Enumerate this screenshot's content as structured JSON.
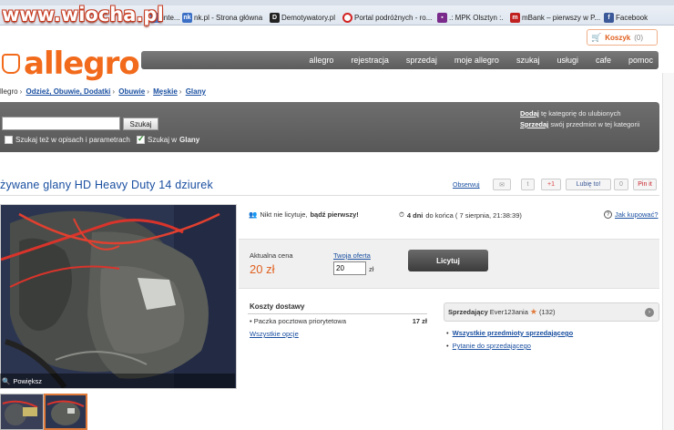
{
  "watermark": "www.wiocha.pl",
  "bookmarks": [
    {
      "label": "inte...",
      "icon": "ie-icon",
      "color": "#4a7bd0"
    },
    {
      "label": "nk.pl - Strona główna",
      "icon": "nk-icon",
      "color": "#3b6fc6"
    },
    {
      "label": "Demotywatory.pl",
      "icon": "d-icon",
      "color": "#222222"
    },
    {
      "label": "Portal podróżnych - ro...",
      "icon": "target-icon",
      "color": "#d22222"
    },
    {
      "label": ".: MPK Olsztyn :.",
      "icon": "bus-icon",
      "color": "#7a2a8a"
    },
    {
      "label": "mBank – pierwszy w P...",
      "icon": "mbank-icon",
      "color": "#c02020"
    },
    {
      "label": "Facebook",
      "icon": "facebook-icon",
      "color": "#3b5998"
    }
  ],
  "header": {
    "cart_label": "Koszyk",
    "cart_count": "(0)",
    "logo_text": "allegro",
    "nav": [
      "allegro",
      "rejestracja",
      "sprzedaj",
      "moje allegro",
      "szukaj",
      "usługi",
      "cafe",
      "pomoc"
    ]
  },
  "breadcrumb": {
    "root": "llegro",
    "items": [
      "Odzież, Obuwie, Dodatki",
      "Obuwie",
      "Męskie",
      "Glany"
    ]
  },
  "search": {
    "button_label": "Szukaj",
    "option_descriptions": "Szukaj też w opisach i parametrach",
    "option_in_prefix": "Szukaj w",
    "option_in_category": "Glany",
    "add_link": "Dodaj",
    "add_text": "tę kategorię do ulubionych",
    "sell_link": "Sprzedaj",
    "sell_text": "swój przedmiot w tej kategorii"
  },
  "item": {
    "title": "żywane glany HD Heavy Duty 14 dziurek",
    "observe": "Obserwuj",
    "gplus": "+1",
    "fb_like": "Lubię to!",
    "fb_count": "0",
    "pin": "Pin it",
    "zoom_label": "Powiększ",
    "bids_text": "Nikt nie licytuje,",
    "bids_cta": "bądź pierwszy!",
    "time_left_bold": "4 dni",
    "time_left_text": "do końca ( 7 sierpnia, 21:38:39)",
    "how_to_buy": "Jak kupować?",
    "price_label": "Aktualna cena",
    "price": "20 zł",
    "your_offer_label": "Twoja oferta",
    "offer_value": "20",
    "offer_unit": "zł",
    "bid_button": "Licytuj"
  },
  "shipping": {
    "title": "Koszty dostawy",
    "method": "Paczka pocztowa priorytetowa",
    "cost": "17 zł",
    "all_options": "Wszystkie opcje"
  },
  "seller": {
    "label": "Sprzedający",
    "name": "Ever123ania",
    "rating": "(132)",
    "all_items": "Wszystkie przedmioty sprzedającego",
    "ask": "Pytanie do sprzedającego"
  }
}
